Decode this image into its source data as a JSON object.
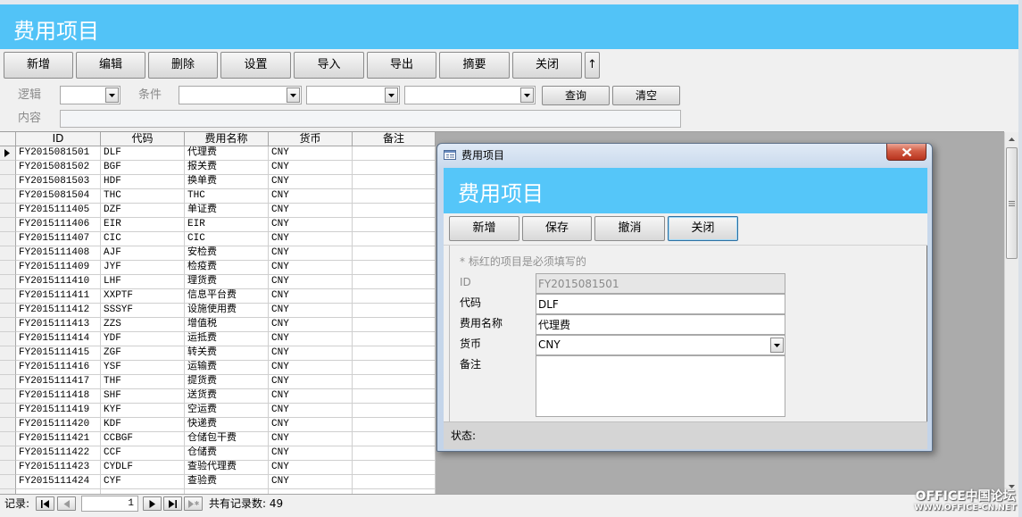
{
  "app": {
    "title": "费用项目"
  },
  "toolbar": {
    "buttons": [
      "新增",
      "编辑",
      "删除",
      "设置",
      "导入",
      "导出",
      "摘要",
      "关闭"
    ],
    "up_label": "↑"
  },
  "search": {
    "logic_label": "逻辑",
    "condition_label": "条件",
    "content_label": "内容",
    "query_button": "查询",
    "clear_button": "清空"
  },
  "grid": {
    "columns": [
      "ID",
      "代码",
      "费用名称",
      "货币",
      "备注"
    ],
    "rows": [
      [
        "FY2015081501",
        "DLF",
        "代理费",
        "CNY",
        ""
      ],
      [
        "FY2015081502",
        "BGF",
        "报关费",
        "CNY",
        ""
      ],
      [
        "FY2015081503",
        "HDF",
        "换单费",
        "CNY",
        ""
      ],
      [
        "FY2015081504",
        "THC",
        "THC",
        "CNY",
        ""
      ],
      [
        "FY2015111405",
        "DZF",
        "单证费",
        "CNY",
        ""
      ],
      [
        "FY2015111406",
        "EIR",
        "EIR",
        "CNY",
        ""
      ],
      [
        "FY2015111407",
        "CIC",
        "CIC",
        "CNY",
        ""
      ],
      [
        "FY2015111408",
        "AJF",
        "安检费",
        "CNY",
        ""
      ],
      [
        "FY2015111409",
        "JYF",
        "检疫费",
        "CNY",
        ""
      ],
      [
        "FY2015111410",
        "LHF",
        "理货费",
        "CNY",
        ""
      ],
      [
        "FY2015111411",
        "XXPTF",
        "信息平台费",
        "CNY",
        ""
      ],
      [
        "FY2015111412",
        "SSSYF",
        "设施使用费",
        "CNY",
        ""
      ],
      [
        "FY2015111413",
        "ZZS",
        "增值税",
        "CNY",
        ""
      ],
      [
        "FY2015111414",
        "YDF",
        "运抵费",
        "CNY",
        ""
      ],
      [
        "FY2015111415",
        "ZGF",
        "转关费",
        "CNY",
        ""
      ],
      [
        "FY2015111416",
        "YSF",
        "运输费",
        "CNY",
        ""
      ],
      [
        "FY2015111417",
        "THF",
        "提货费",
        "CNY",
        ""
      ],
      [
        "FY2015111418",
        "SHF",
        "送货费",
        "CNY",
        ""
      ],
      [
        "FY2015111419",
        "KYF",
        "空运费",
        "CNY",
        ""
      ],
      [
        "FY2015111420",
        "KDF",
        "快递费",
        "CNY",
        ""
      ],
      [
        "FY2015111421",
        "CCBGF",
        "仓储包干费",
        "CNY",
        ""
      ],
      [
        "FY2015111422",
        "CCF",
        "仓储费",
        "CNY",
        ""
      ],
      [
        "FY2015111423",
        "CYDLF",
        "查验代理费",
        "CNY",
        ""
      ],
      [
        "FY2015111424",
        "CYF",
        "查验费",
        "CNY",
        ""
      ]
    ]
  },
  "navigation": {
    "label": "记录:",
    "current_record": "1",
    "total_text": "共有记录数: 49"
  },
  "dialog": {
    "window_title": "费用项目",
    "header_title": "费用项目",
    "buttons": [
      "新增",
      "保存",
      "撤消",
      "关闭"
    ],
    "required_note": "* 标红的项目是必须填写的",
    "fields": [
      {
        "label": "ID",
        "value": "FY2015081501"
      },
      {
        "label": "代码",
        "value": "DLF"
      },
      {
        "label": "费用名称",
        "value": "代理费"
      },
      {
        "label": "货币",
        "value": "CNY"
      },
      {
        "label": "备注",
        "value": ""
      }
    ],
    "status_label": "状态:"
  },
  "watermark": {
    "line1": "OFFICE中国论坛",
    "line2": "WWW.OFFICE-CN.NET"
  },
  "icons": {
    "window": "form-icon",
    "close": "close-icon",
    "dropdown": "chevron-down-icon",
    "row_indicator": "current-record-indicator-icon",
    "nav_first": "first-record-icon",
    "nav_prev": "previous-record-icon",
    "nav_next": "next-record-icon",
    "nav_last": "last-record-icon",
    "nav_new": "new-record-icon",
    "scroll_up": "scroll-up-icon",
    "scroll_down": "scroll-down-icon"
  },
  "colors": {
    "header": "#52c3f7",
    "dialog_header": "#55c6f9",
    "empty_area": "#ababab",
    "close_button": "#c9462e",
    "window_frame": "#c7d7ea"
  }
}
